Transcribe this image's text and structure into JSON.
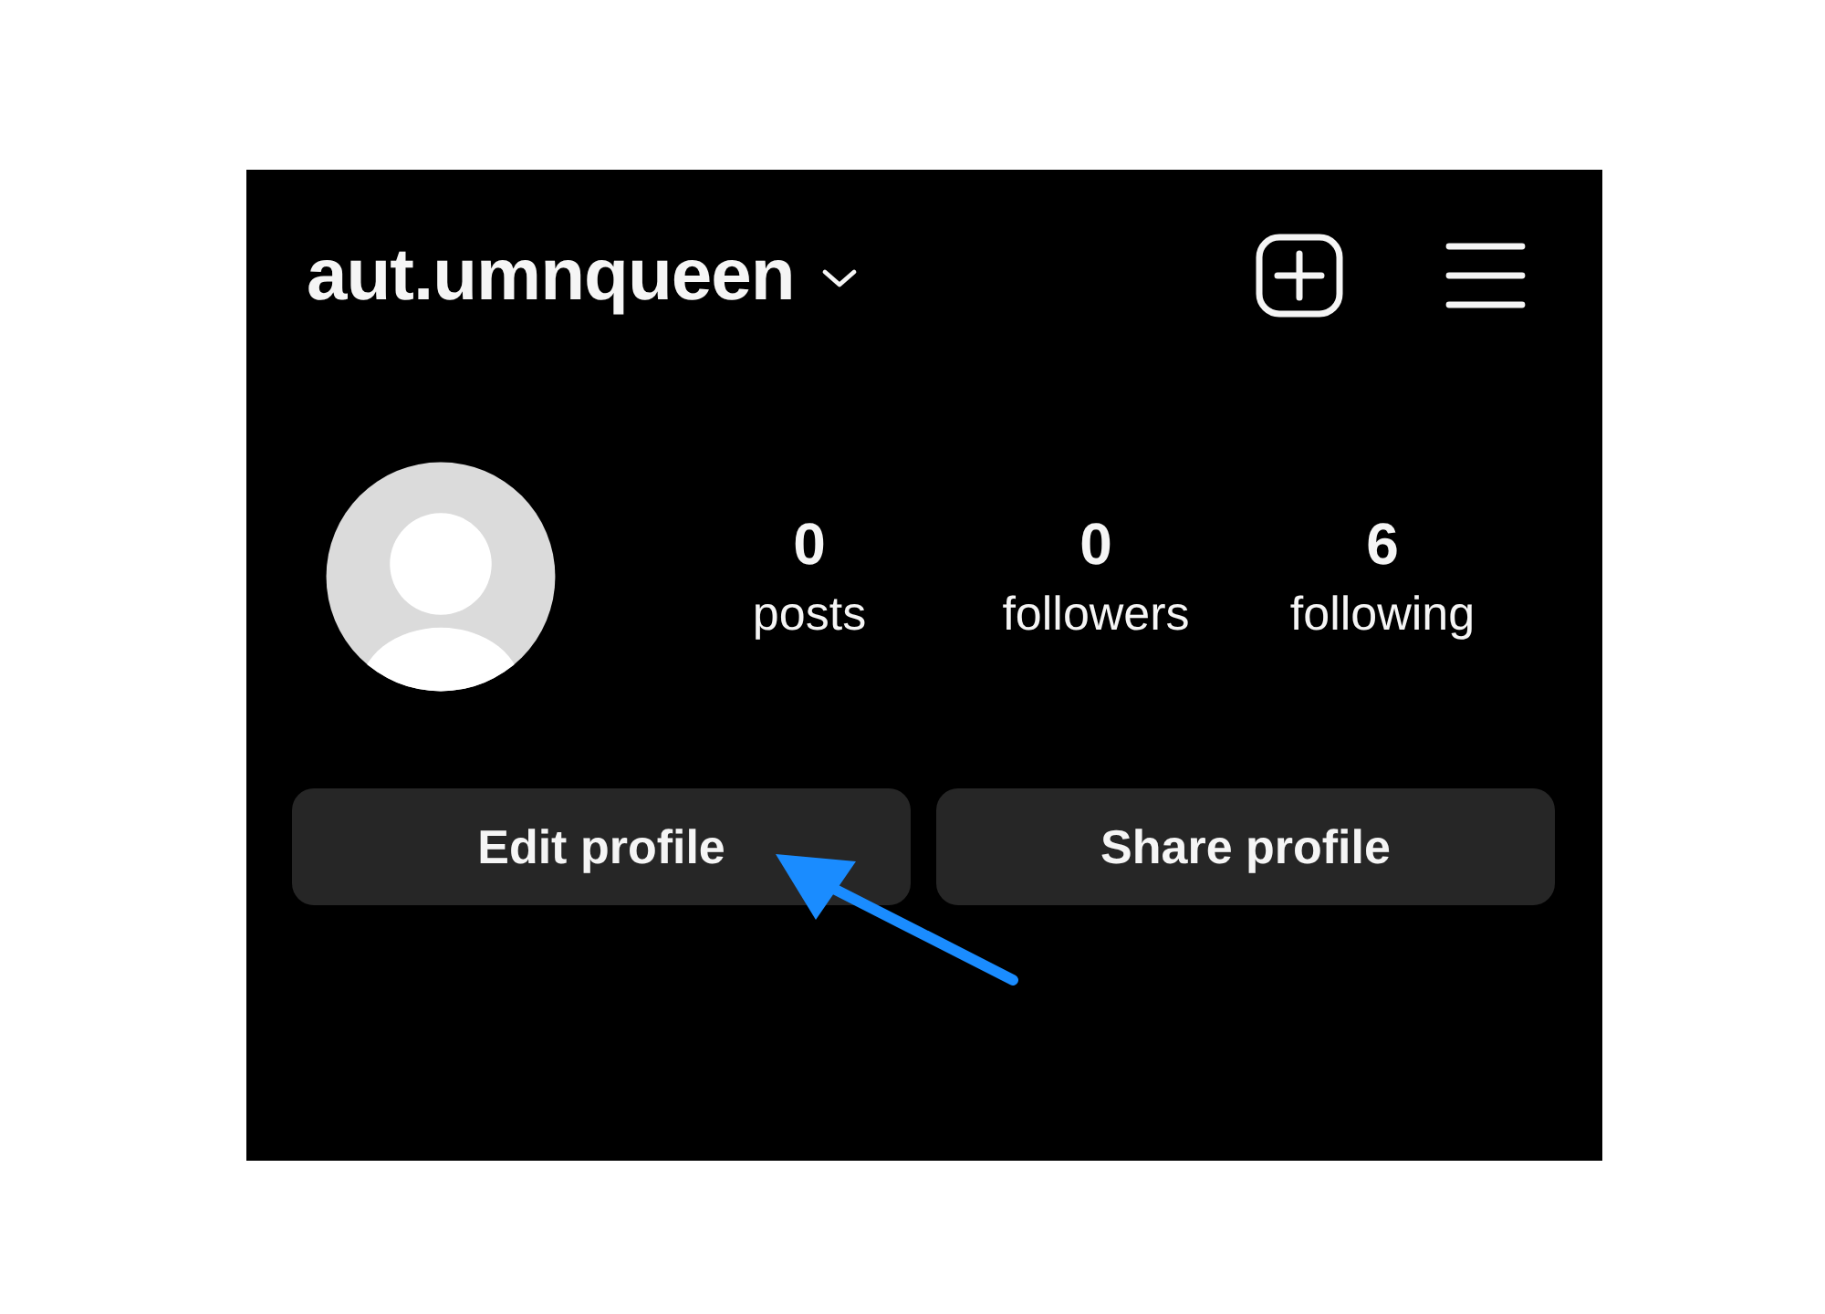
{
  "header": {
    "username": "aut.umnqueen"
  },
  "stats": [
    {
      "value": "0",
      "label": "posts"
    },
    {
      "value": "0",
      "label": "followers"
    },
    {
      "value": "6",
      "label": "following"
    }
  ],
  "buttons": [
    "Edit profile",
    "Share profile"
  ]
}
